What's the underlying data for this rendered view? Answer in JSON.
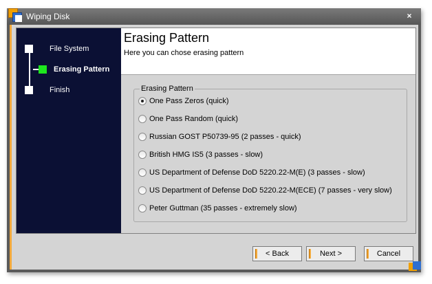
{
  "window": {
    "title": "Wiping Disk",
    "close_glyph": "×"
  },
  "sidebar": {
    "steps": [
      {
        "label": "File System",
        "active": false
      },
      {
        "label": "Erasing Pattern",
        "active": true
      },
      {
        "label": "Finish",
        "active": false
      }
    ]
  },
  "header": {
    "title": "Erasing Pattern",
    "subtitle": "Here you can chose erasing pattern"
  },
  "group": {
    "legend": "Erasing Pattern",
    "options": [
      {
        "label": "One Pass Zeros (quick)",
        "checked": true
      },
      {
        "label": "One Pass Random (quick)",
        "checked": false
      },
      {
        "label": "Russian GOST P50739-95 (2 passes - quick)",
        "checked": false
      },
      {
        "label": "British HMG IS5 (3 passes - slow)",
        "checked": false
      },
      {
        "label": "US Department of Defense DoD 5220.22-M(E) (3 passes - slow)",
        "checked": false
      },
      {
        "label": "US Department of Defense DoD 5220.22-M(ECE) (7 passes - very slow)",
        "checked": false
      },
      {
        "label": "Peter Guttman (35 passes - extremely slow)",
        "checked": false
      }
    ]
  },
  "buttons": {
    "back": "< Back",
    "next": "Next >",
    "cancel": "Cancel"
  },
  "colors": {
    "sidebar_bg": "#0b1034",
    "active_step": "#1ee61e",
    "accent": "#f2a93b"
  }
}
